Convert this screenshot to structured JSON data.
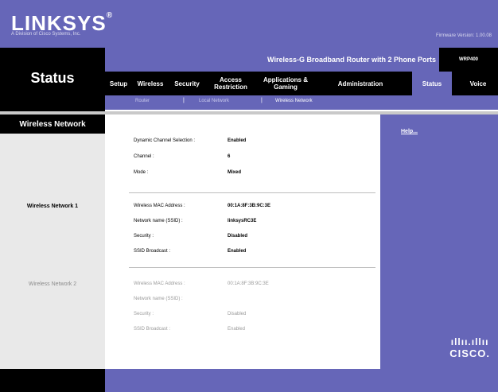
{
  "brand": {
    "logo": "LINKSYS",
    "logo_mark": "®",
    "tagline": "A Division of Cisco Systems, Inc.",
    "firmware": "Firmware Version: 1.00.08"
  },
  "page_title": "Status",
  "product": {
    "name": "Wireless-G Broadband Router with 2 Phone Ports",
    "model": "WRP400"
  },
  "nav": {
    "tabs": [
      "Setup",
      "Wireless",
      "Security",
      "Access Restriction",
      "Applications & Gaming",
      "Administration",
      "Status",
      "Voice"
    ],
    "active": "Status"
  },
  "subnav": {
    "items": [
      "Router",
      "Local Network",
      "Wireless Network"
    ],
    "selected": "Wireless Network"
  },
  "sidebar": {
    "section": "Wireless Network",
    "network1": "Wireless Network 1",
    "network2": "Wireless Network 2"
  },
  "general": {
    "dcs_label": "Dynamic Channel Selection :",
    "dcs_value": "Enabled",
    "channel_label": "Channel :",
    "channel_value": "6",
    "mode_label": "Mode :",
    "mode_value": "Mixed"
  },
  "network1": {
    "mac_label": "Wireless MAC Address :",
    "mac_value": "00:1A:8F:3B:9C:3E",
    "ssid_label": "Network name (SSID) :",
    "ssid_value": "linksysRC3E",
    "security_label": "Security :",
    "security_value": "Disabled",
    "broadcast_label": "SSID Broadcast :",
    "broadcast_value": "Enabled"
  },
  "network2": {
    "mac_label": "Wireless MAC Address :",
    "mac_value": "00:1A:8F:3B:9C:3E",
    "ssid_label": "Network name (SSID) :",
    "ssid_value": "",
    "security_label": "Security :",
    "security_value": "Disabled",
    "broadcast_label": "SSID Broadcast :",
    "broadcast_value": "Enabled"
  },
  "help": {
    "link": "Help..."
  },
  "footer": {
    "cisco_bars": "ahah",
    "cisco_word": "CISCO."
  },
  "colors": {
    "accent": "#6666b8",
    "header_black": "#000000",
    "panel_grey": "#e9e9e9"
  }
}
